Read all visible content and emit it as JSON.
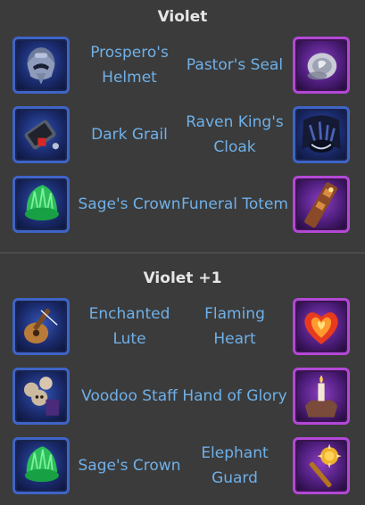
{
  "sections": [
    {
      "title": "Violet",
      "rows": [
        {
          "left": {
            "name": "Prospero's Helmet",
            "icon": "plague-helmet-icon",
            "rarity": "blue"
          },
          "right": {
            "name": "Pastor's Seal",
            "icon": "seal-ring-icon",
            "rarity": "purple"
          }
        },
        {
          "left": {
            "name": "Dark Grail",
            "icon": "dark-grail-icon",
            "rarity": "blue"
          },
          "right": {
            "name": "Raven King's Cloak",
            "icon": "raven-cloak-icon",
            "rarity": "blue"
          }
        },
        {
          "left": {
            "name": "Sage's Crown",
            "icon": "green-crown-icon",
            "rarity": "blue"
          },
          "right": {
            "name": "Funeral Totem",
            "icon": "totem-icon",
            "rarity": "purple"
          }
        }
      ]
    },
    {
      "title": "Violet +1",
      "rows": [
        {
          "left": {
            "name": "Enchanted Lute",
            "icon": "lute-icon",
            "rarity": "blue"
          },
          "right": {
            "name": "Flaming Heart",
            "icon": "flaming-heart-icon",
            "rarity": "purple"
          }
        },
        {
          "left": {
            "name": "Voodoo Staff",
            "icon": "skull-staff-icon",
            "rarity": "blue"
          },
          "right": {
            "name": "Hand of Glory",
            "icon": "candle-hand-icon",
            "rarity": "purple"
          }
        },
        {
          "left": {
            "name": "Sage's Crown",
            "icon": "green-crown-icon",
            "rarity": "blue"
          },
          "right": {
            "name": "Elephant Guard",
            "icon": "golden-mace-icon",
            "rarity": "purple"
          }
        }
      ]
    }
  ],
  "colors": {
    "background": "#3b3b3b",
    "item_name": "#6fb0e8",
    "heading": "#e6e6e6",
    "blue_frame": "#3f64c7",
    "purple_frame": "#b348d6"
  }
}
